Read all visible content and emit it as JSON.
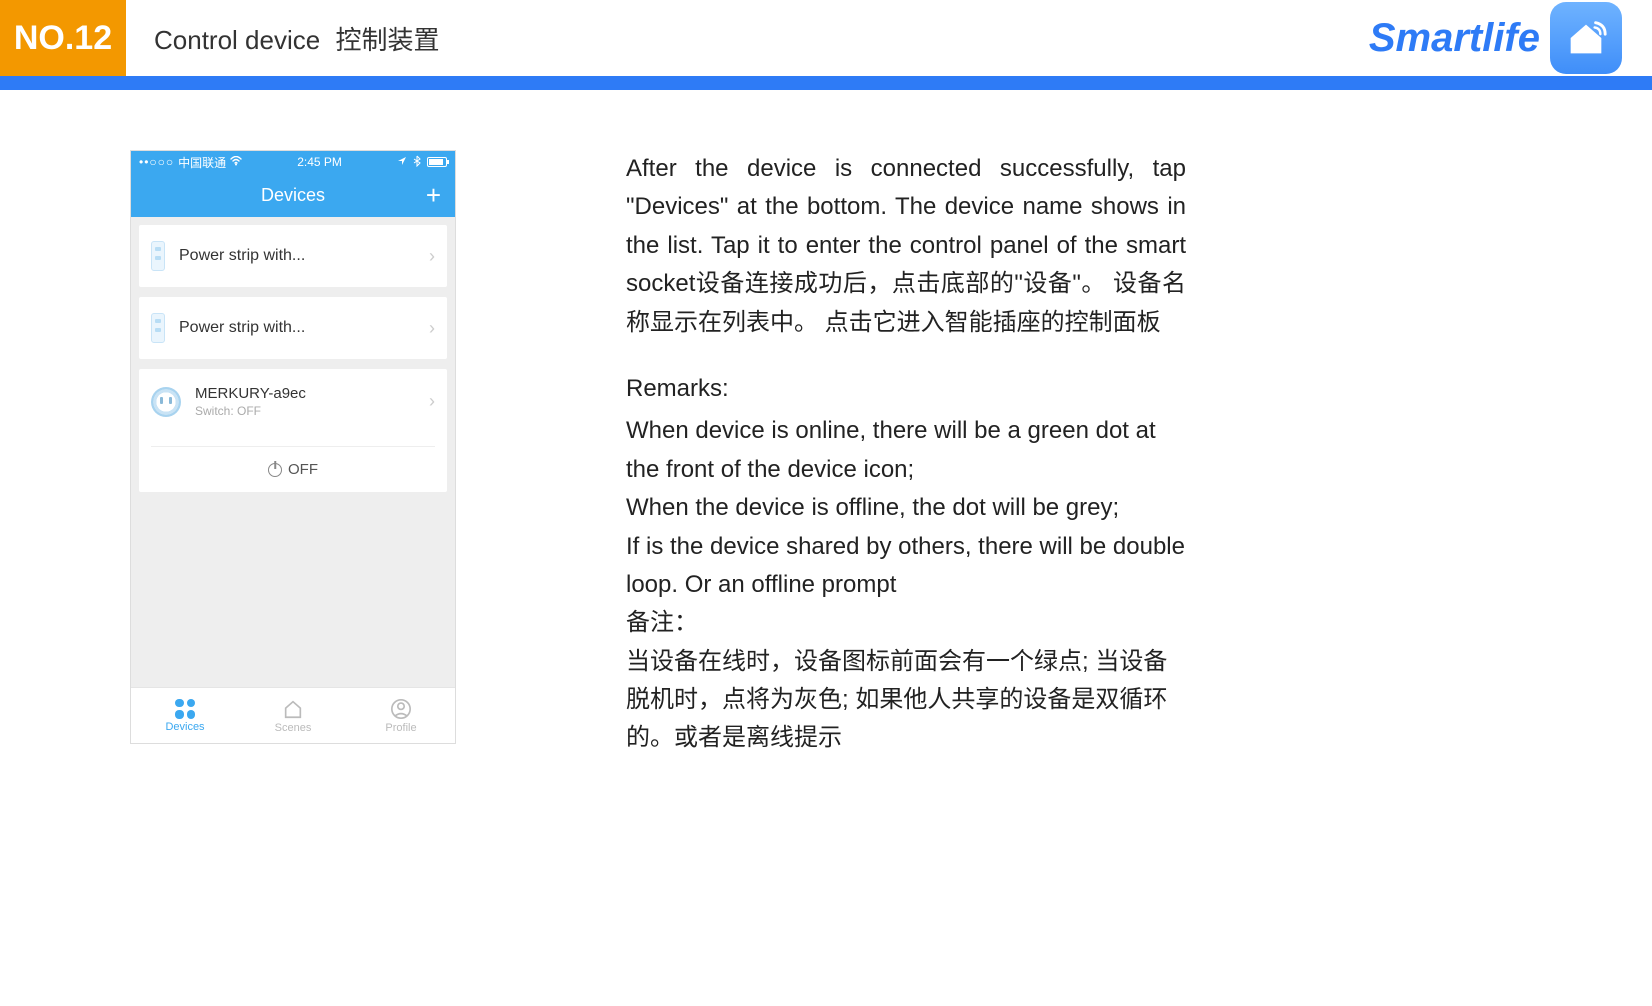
{
  "header": {
    "page_number": "NO.12",
    "title_en": "Control device",
    "title_zh": "控制装置",
    "brand": "Smartlife"
  },
  "phone": {
    "status": {
      "carrier": "中国联通",
      "time": "2:45 PM"
    },
    "nav_title": "Devices",
    "nav_add": "+",
    "devices": [
      {
        "name": "Power strip with...",
        "type": "strip"
      },
      {
        "name": "Power strip with...",
        "type": "strip"
      },
      {
        "name": "MERKURY-a9ec",
        "sub": "Switch: OFF",
        "type": "plug",
        "expanded": true,
        "off_label": "OFF"
      }
    ],
    "tabs": [
      {
        "label": "Devices",
        "active": true
      },
      {
        "label": "Scenes",
        "active": false
      },
      {
        "label": "Profile",
        "active": false
      }
    ]
  },
  "description": {
    "para1": "After the device is connected successfully, tap \"Devices\" at the bottom. The device name shows in the list. Tap it to enter the control panel of the smart socket设备连接成功后，点击底部的\"设备\"。 设备名称显示在列表中。   点击它进入智能插座的控制面板",
    "remarks_title": "Remarks:",
    "remarks_en_1": "When device is online, there will be a green dot at the front of the device icon;",
    "remarks_en_2": "When the device is offline, the dot will be grey;",
    "remarks_en_3": "If is the device shared by others, there will be double loop. Or an offline prompt",
    "remarks_zh_title": "备注：",
    "remarks_zh_body": "当设备在线时，设备图标前面会有一个绿点; 当设备脱机时，点将为灰色; 如果他人共享的设备是双循环的。或者是离线提示"
  }
}
